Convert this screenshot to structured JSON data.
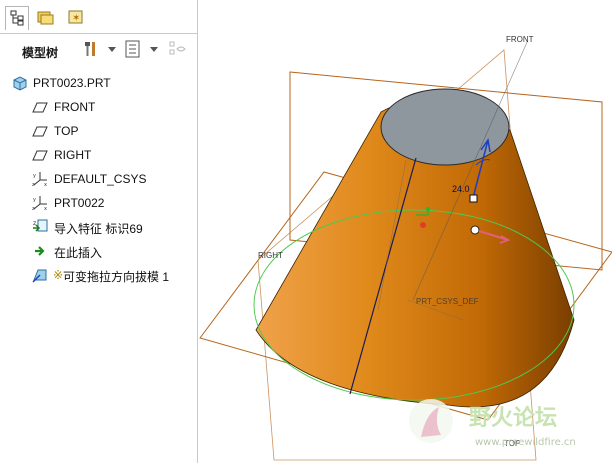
{
  "panel": {
    "tree_title": "模型树",
    "items": [
      {
        "label": "PRT0023.PRT",
        "icon": "part-icon"
      },
      {
        "label": "FRONT",
        "icon": "datum-plane-icon"
      },
      {
        "label": "TOP",
        "icon": "datum-plane-icon"
      },
      {
        "label": "RIGHT",
        "icon": "datum-plane-icon"
      },
      {
        "label": "DEFAULT_CSYS",
        "icon": "csys-icon"
      },
      {
        "label": "PRT0022",
        "icon": "csys-icon"
      },
      {
        "label": "导入特征 标识69",
        "icon": "import-feature-icon"
      },
      {
        "label": "在此插入",
        "icon": "insert-here-arrow-icon"
      },
      {
        "label": "可变拖拉方向拔模 1",
        "marker": "※",
        "icon": "draft-feature-icon"
      }
    ]
  },
  "viewport": {
    "plane_labels": {
      "front": "FRONT",
      "right": "RIGHT",
      "top": "TOP",
      "csys": "PRT_CSYS_DEF"
    },
    "dimension_value": "24.0"
  },
  "watermark": {
    "name": "野火论坛",
    "url": "www.proewildfire.cn"
  },
  "colors": {
    "cone_orange": "#e0860f",
    "top_face": "#8e969e",
    "datum_plane": "#b5651d",
    "edge_green": "#4fc84f",
    "axis_blue": "#1f3fbf",
    "drag_pink": "#e0607a"
  }
}
